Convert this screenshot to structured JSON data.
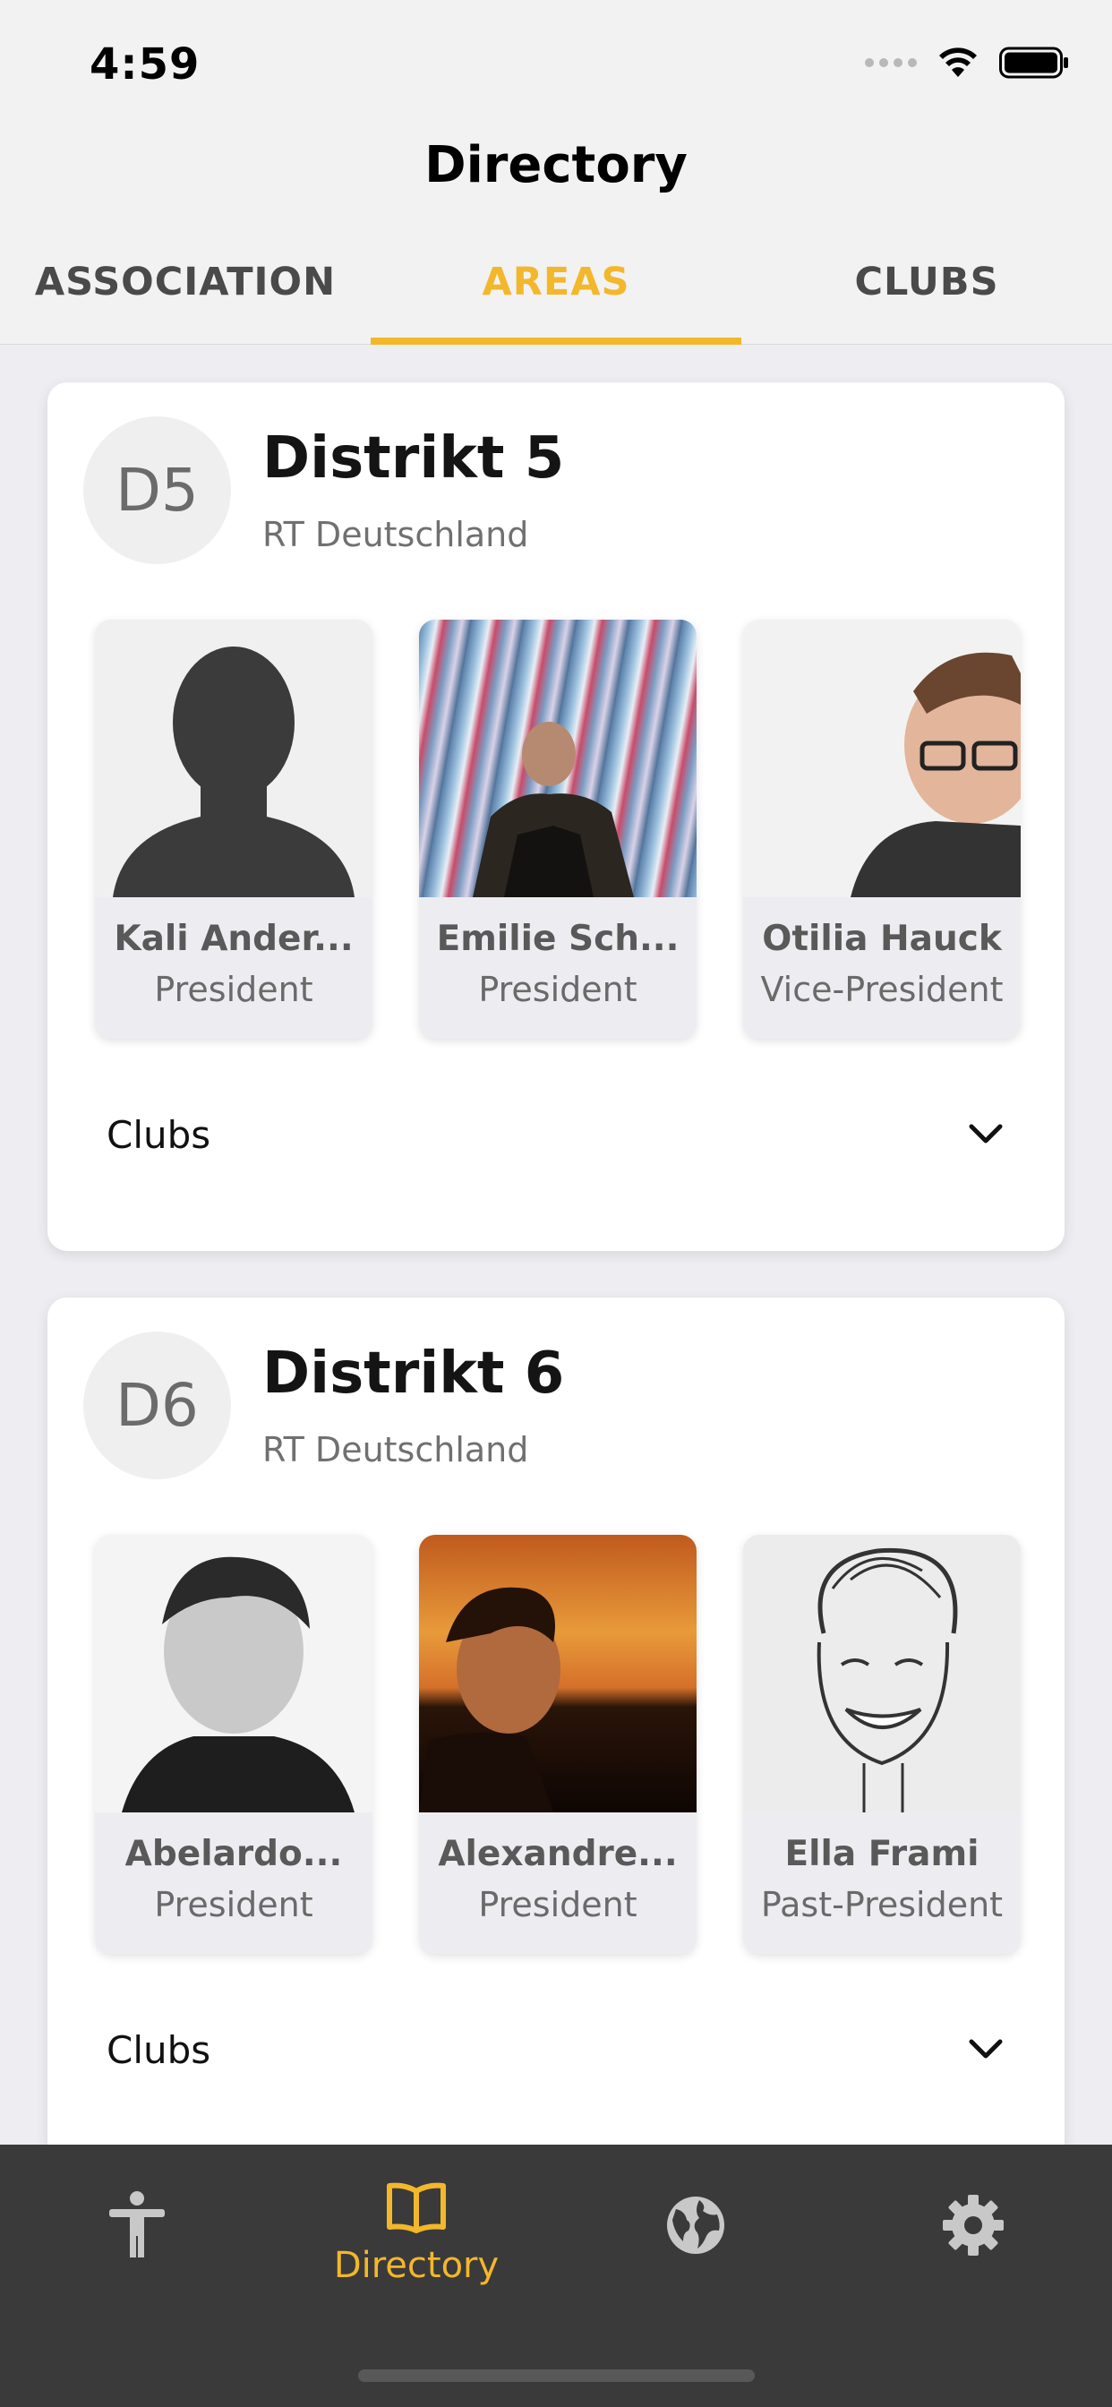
{
  "status": {
    "time": "4:59"
  },
  "header": {
    "title": "Directory"
  },
  "tabs": [
    {
      "label": "ASSOCIATION",
      "active": false
    },
    {
      "label": "AREAS",
      "active": true
    },
    {
      "label": "CLUBS",
      "active": false
    }
  ],
  "areas": [
    {
      "badge": "D5",
      "name": "Distrikt 5",
      "subtitle": "RT Deutschland",
      "members": [
        {
          "name": "Kali Ander...",
          "role": "President",
          "photo": "silhouette-placeholder"
        },
        {
          "name": "Emilie Sch...",
          "role": "President",
          "photo": "man-under-colored-tubes"
        },
        {
          "name": "Otilia Hauck",
          "role": "Vice-President",
          "photo": "man-with-glasses"
        }
      ],
      "clubs_label": "Clubs"
    },
    {
      "badge": "D6",
      "name": "Distrikt 6",
      "subtitle": "RT Deutschland",
      "members": [
        {
          "name": "Abelardo...",
          "role": "President",
          "photo": "bw-portrait-man"
        },
        {
          "name": "Alexandre...",
          "role": "President",
          "photo": "man-at-sunset"
        },
        {
          "name": "Ella Frami",
          "role": "Past-President",
          "photo": "caricature-sketch"
        }
      ],
      "clubs_label": "Clubs"
    }
  ],
  "tabbar": {
    "items": [
      {
        "icon": "accessibility-icon",
        "label": ""
      },
      {
        "icon": "book-icon",
        "label": "Directory",
        "active": true
      },
      {
        "icon": "globe-icon",
        "label": ""
      },
      {
        "icon": "gear-icon",
        "label": ""
      }
    ]
  },
  "colors": {
    "accent": "#f3b72b",
    "tabbar_bg": "#3a3a3a",
    "icon_inactive": "#c8c8c8"
  }
}
